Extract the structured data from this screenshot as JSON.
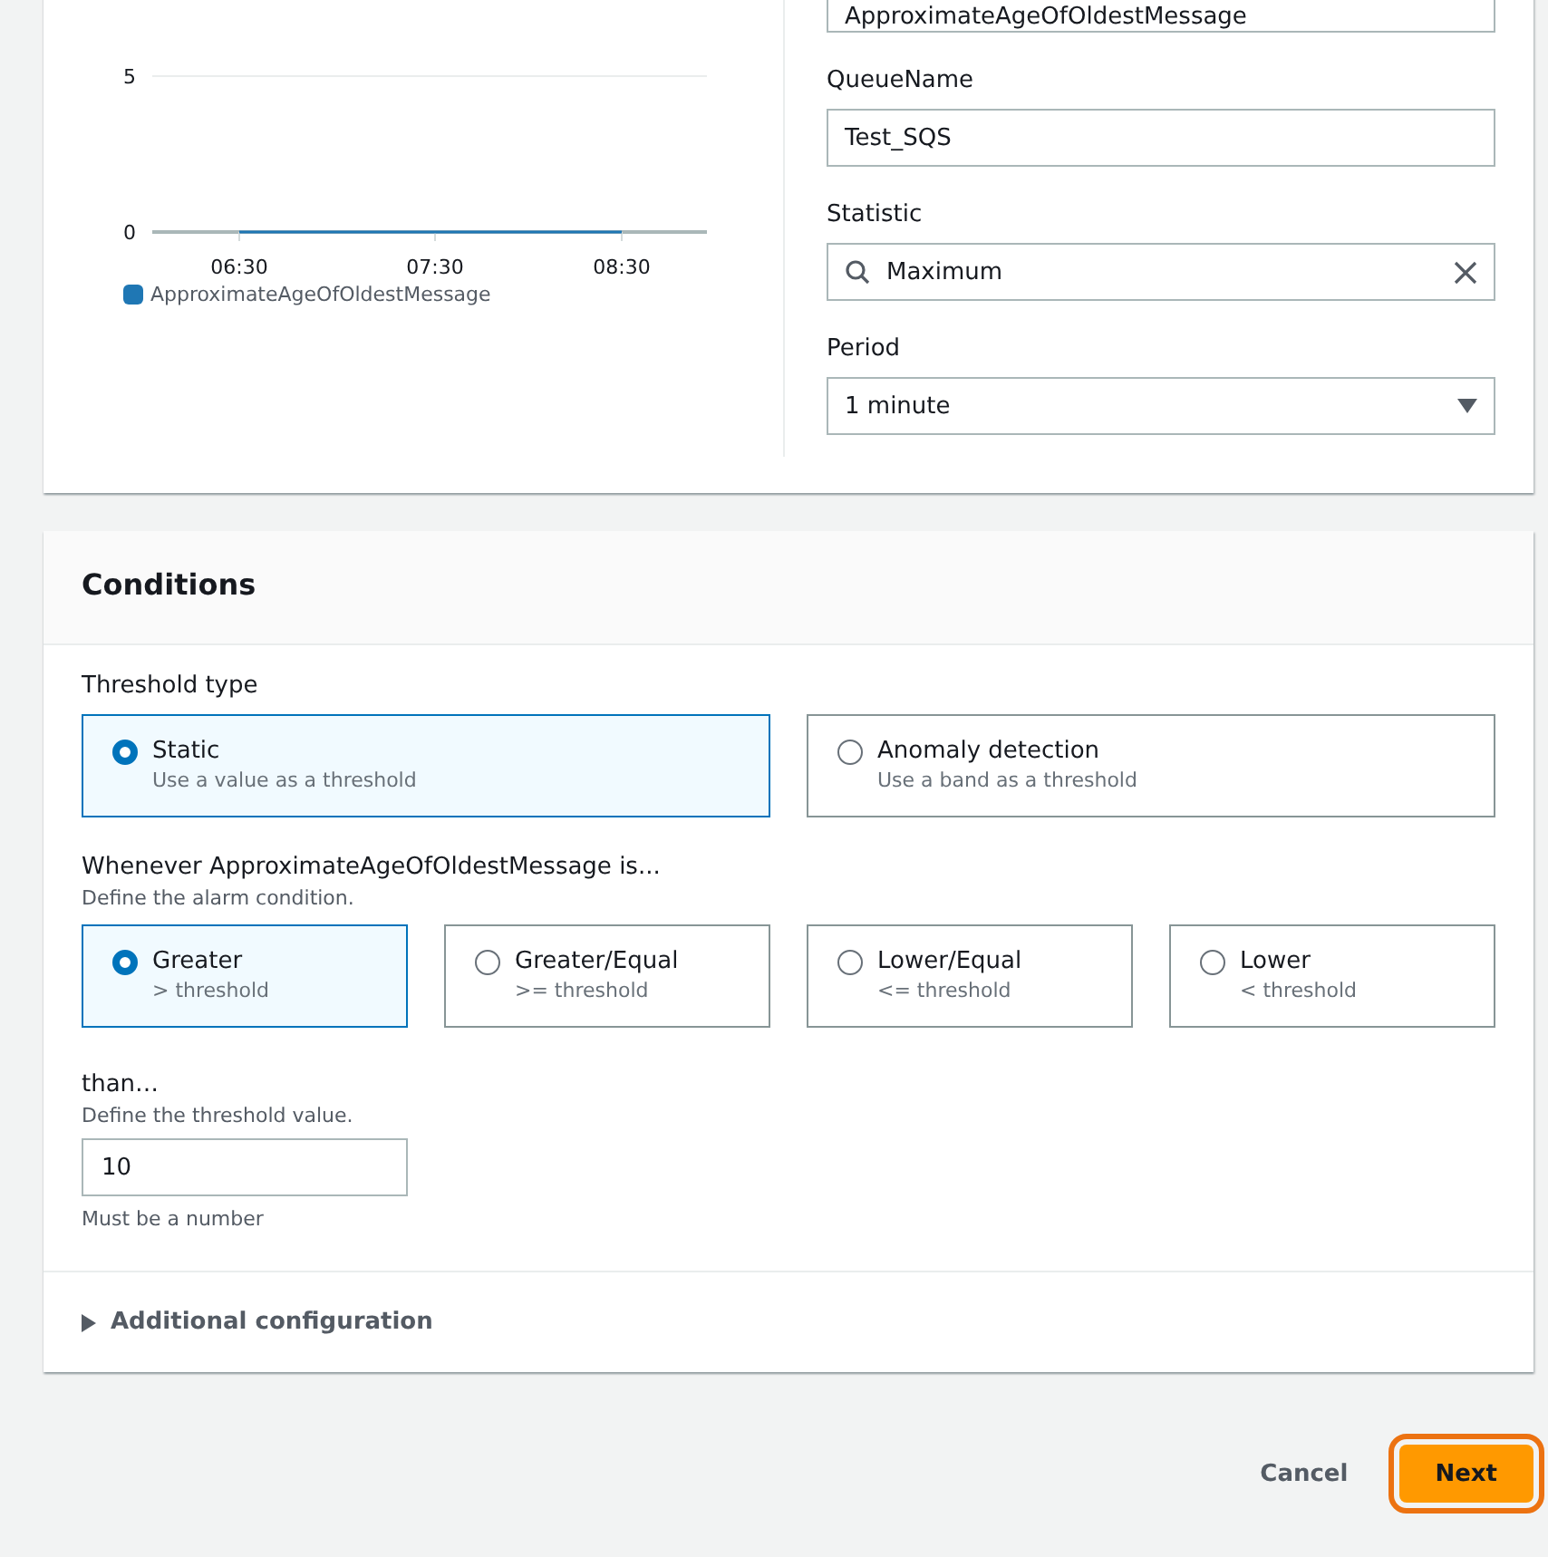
{
  "metric": {
    "chart_data": {
      "type": "line",
      "categories": [
        "06:30",
        "07:30",
        "08:30"
      ],
      "yticks": [
        0,
        5
      ],
      "ylim": [
        0,
        5
      ],
      "series": [
        {
          "name": "ApproximateAgeOfOldestMessage",
          "color": "#1f77b4",
          "values": [
            0,
            0,
            0
          ]
        }
      ]
    },
    "fields": [
      {
        "kind": "text",
        "value": "ApproximateAgeOfOldestMessage"
      },
      {
        "kind": "text",
        "label": "QueueName",
        "value": "Test_SQS"
      },
      {
        "kind": "search",
        "label": "Statistic",
        "value": "Maximum"
      },
      {
        "kind": "select",
        "label": "Period",
        "value": "1 minute"
      }
    ]
  },
  "conditions": {
    "title": "Conditions",
    "threshold_type": {
      "label": "Threshold type",
      "options": [
        {
          "label": "Static",
          "description": "Use a value as a threshold",
          "selected": true
        },
        {
          "label": "Anomaly detection",
          "description": "Use a band as a threshold",
          "selected": false
        }
      ]
    },
    "whenever": {
      "label": "Whenever ApproximateAgeOfOldestMessage is...",
      "help": "Define the alarm condition.",
      "options": [
        {
          "label": "Greater",
          "description": "> threshold",
          "selected": true
        },
        {
          "label": "Greater/Equal",
          "description": ">= threshold",
          "selected": false
        },
        {
          "label": "Lower/Equal",
          "description": "<= threshold",
          "selected": false
        },
        {
          "label": "Lower",
          "description": "< threshold",
          "selected": false
        }
      ]
    },
    "than": {
      "label": "than…",
      "help": "Define the threshold value.",
      "value": "10",
      "constraint": "Must be a number"
    },
    "additional": {
      "label": "Additional configuration",
      "expanded": false
    }
  },
  "actions": [
    {
      "kind": "link",
      "label": "Cancel"
    },
    {
      "kind": "primary",
      "label": "Next",
      "focused": true
    }
  ]
}
